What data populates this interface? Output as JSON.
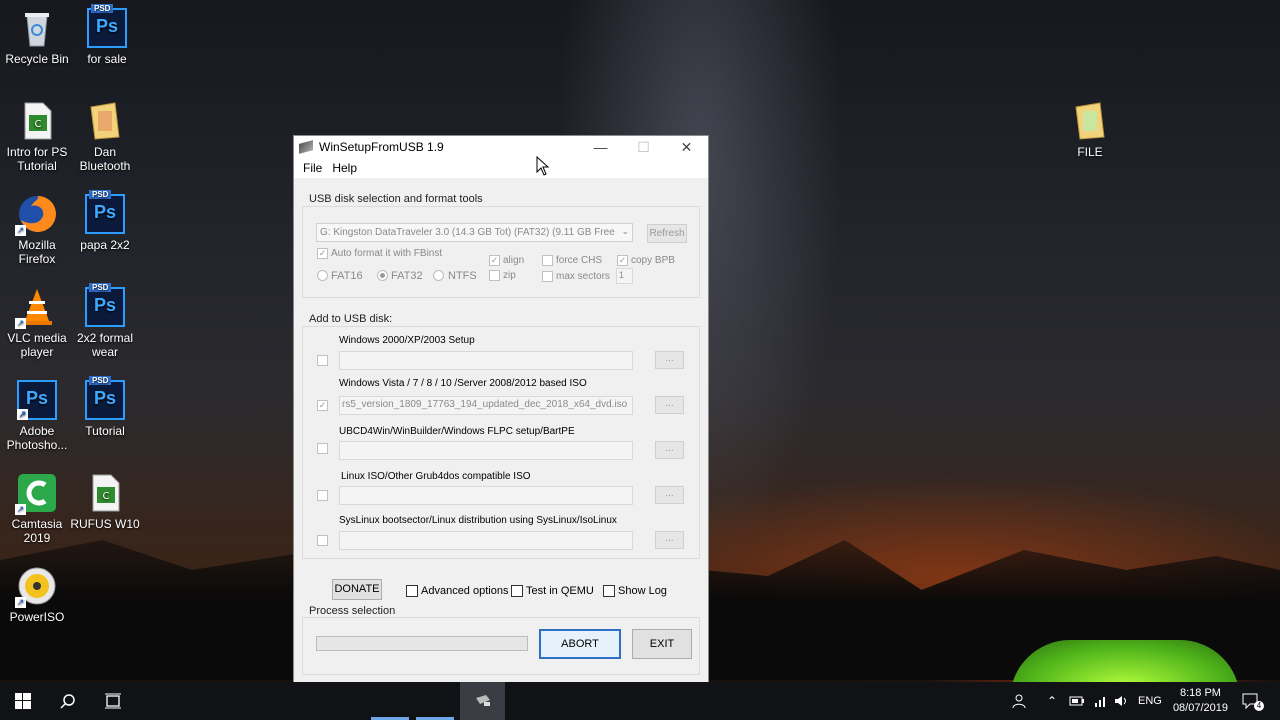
{
  "desktop": {
    "icons": [
      {
        "label": "Recycle Bin",
        "icon": "recycle-bin-icon"
      },
      {
        "label": "for sale",
        "icon": "psd-file-icon",
        "tag": "PSD",
        "glyph": "Ps"
      },
      {
        "label": "Intro for PS Tutorial",
        "icon": "camtasia-project-icon"
      },
      {
        "label": "Dan Bluetooth",
        "icon": "folder-icon"
      },
      {
        "label": "Mozilla Firefox",
        "icon": "firefox-icon"
      },
      {
        "label": "papa 2x2",
        "icon": "psd-file-icon",
        "tag": "PSD",
        "glyph": "Ps"
      },
      {
        "label": "VLC media player",
        "icon": "vlc-icon"
      },
      {
        "label": "2x2 formal wear",
        "icon": "psd-file-icon",
        "tag": "PSD",
        "glyph": "Ps"
      },
      {
        "label": "Adobe Photosho...",
        "icon": "photoshop-icon",
        "glyph": "Ps"
      },
      {
        "label": "Tutorial",
        "icon": "psd-file-icon",
        "tag": "PSD",
        "glyph": "Ps"
      },
      {
        "label": "Camtasia 2019",
        "icon": "camtasia-icon"
      },
      {
        "label": "RUFUS W10",
        "icon": "camtasia-project-icon"
      },
      {
        "label": "PowerISO",
        "icon": "poweriso-icon"
      },
      {
        "label": "FILE",
        "icon": "folder-icon"
      }
    ]
  },
  "window": {
    "title": "WinSetupFromUSB 1.9",
    "menu": [
      "File",
      "Help"
    ],
    "usb_group": {
      "label": "USB disk selection and format tools",
      "disk": "G: Kingston DataTraveler 3.0 (14.3 GB Tot) (FAT32) (9.11 GB Free",
      "refresh": "Refresh",
      "auto_format": "Auto format it with FBinst",
      "fs_options": [
        "FAT16",
        "FAT32",
        "NTFS"
      ],
      "selected_fs": "FAT32",
      "align": "align",
      "zip": "zip",
      "force_chs": "force CHS",
      "max_sectors": "max sectors",
      "copy_bpb": "copy BPB",
      "max_sectors_value": "1"
    },
    "add_group": {
      "label": "Add to USB disk:",
      "items": [
        {
          "label": "Windows 2000/XP/2003 Setup",
          "value": "",
          "checked": false
        },
        {
          "label": "Windows Vista / 7 / 8 / 10 /Server 2008/2012 based ISO",
          "value": "rs5_version_1809_17763_194_updated_dec_2018_x64_dvd.iso",
          "checked": true
        },
        {
          "label": "UBCD4Win/WinBuilder/Windows FLPC setup/BartPE",
          "value": "",
          "checked": false
        },
        {
          "label": "Linux ISO/Other Grub4dos compatible ISO",
          "value": "",
          "checked": false
        },
        {
          "label": "SysLinux bootsector/Linux distribution using SysLinux/IsoLinux",
          "value": "",
          "checked": false
        }
      ],
      "browse": "..."
    },
    "donate": "DONATE",
    "advanced_options": "Advanced options",
    "test_in_qemu": "Test in QEMU",
    "show_log": "Show Log",
    "process_label": "Process selection",
    "progress": 0,
    "abort": "ABORT",
    "exit": "EXIT"
  },
  "taskbar": {
    "language": "ENG",
    "time": "8:18 PM",
    "date": "08/07/2019",
    "notifications": "4"
  }
}
